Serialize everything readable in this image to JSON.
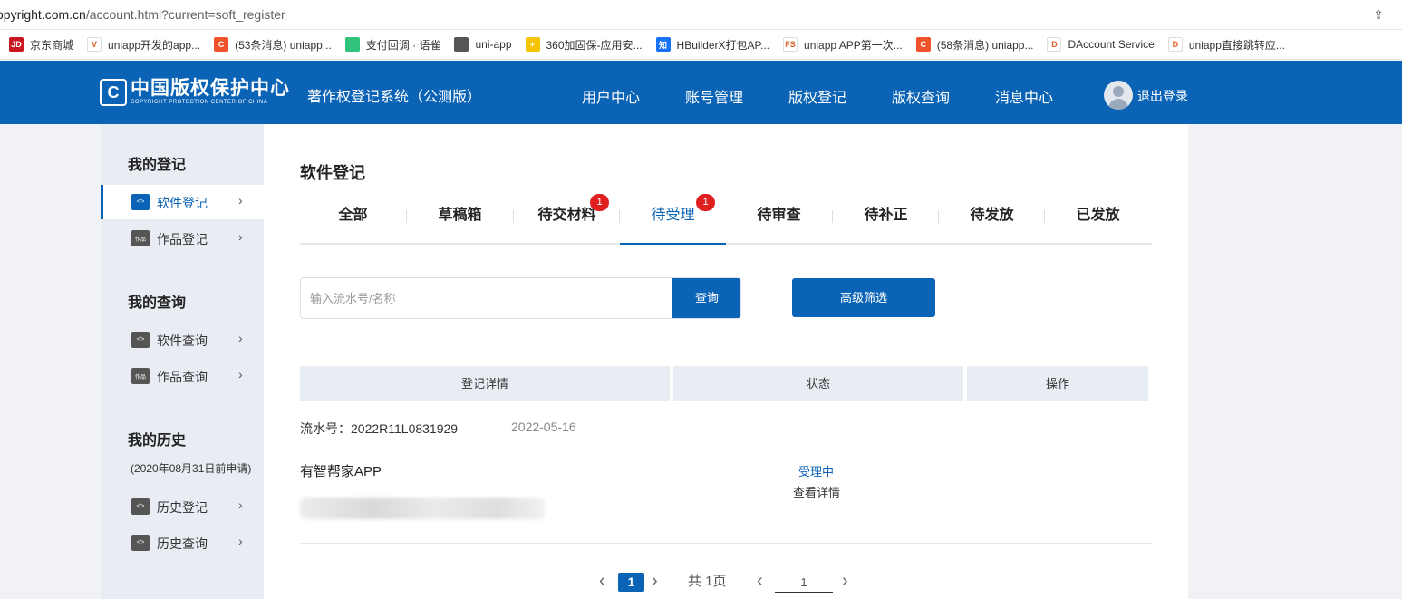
{
  "browser": {
    "url_host": "opyright.com.cn",
    "url_path": "/account.html?current=soft_register",
    "bookmarks": [
      {
        "icon": "jd-icon",
        "badge": "JD",
        "color": "#c81623",
        "label": "京东商城"
      },
      {
        "icon": "uniapp-icon",
        "badge": "V",
        "color": "#ffffff",
        "label": "uniapp开发的app..."
      },
      {
        "icon": "csdn-icon",
        "badge": "C",
        "color": "#f0532a",
        "label": "(53条消息) uniapp..."
      },
      {
        "icon": "yuque-icon",
        "badge": "",
        "color": "#31c27c",
        "label": "支付回调 · 语雀"
      },
      {
        "icon": "globe-icon",
        "badge": "",
        "color": "#555555",
        "label": "uni-app"
      },
      {
        "icon": "360-icon",
        "badge": "+",
        "color": "#f4c500",
        "label": "360加固保-应用安..."
      },
      {
        "icon": "zhihu-icon",
        "badge": "知",
        "color": "#1772f6",
        "label": "HBuilderX打包AP..."
      },
      {
        "icon": "fs-icon",
        "badge": "FS",
        "color": "#ffffff",
        "label": "uniapp APP第一次..."
      },
      {
        "icon": "csdn-icon",
        "badge": "C",
        "color": "#f0532a",
        "label": "(58条消息) uniapp..."
      },
      {
        "icon": "dcloud-icon",
        "badge": "D",
        "color": "#ffffff",
        "label": "DAccount Service"
      },
      {
        "icon": "dcloud-icon",
        "badge": "D",
        "color": "#ffffff",
        "label": "uniapp直接跳转应..."
      }
    ]
  },
  "header": {
    "logo_cn": "中国版权保护中心",
    "logo_en": "COPYRIGHT PROTECTION CENTER OF CHINA",
    "logo_mark": "C",
    "system_name": "著作权登记系统（公测版）",
    "nav": [
      "用户中心",
      "账号管理",
      "版权登记",
      "版权查询",
      "消息中心"
    ],
    "logout": "退出登录",
    "brand_color": "#0a63b4"
  },
  "sidebar": {
    "sections": [
      {
        "title": "我的登记",
        "items": [
          {
            "label": "软件登记",
            "icon": "software-icon",
            "active": true
          },
          {
            "label": "作品登记",
            "icon": "works-icon",
            "active": false
          }
        ]
      },
      {
        "title": "我的查询",
        "items": [
          {
            "label": "软件查询",
            "icon": "software-icon",
            "active": false
          },
          {
            "label": "作品查询",
            "icon": "works-icon",
            "active": false
          }
        ]
      },
      {
        "title": "我的历史",
        "note": "(2020年08月31日前申请)",
        "items": [
          {
            "label": "历史登记",
            "icon": "software-icon",
            "active": false
          },
          {
            "label": "历史查询",
            "icon": "software-icon",
            "active": false
          }
        ]
      }
    ]
  },
  "main": {
    "title": "软件登记",
    "tabs": [
      {
        "label": "全部"
      },
      {
        "label": "草稿箱"
      },
      {
        "label": "待交材料",
        "badge": "1"
      },
      {
        "label": "待受理",
        "badge": "1",
        "active": true
      },
      {
        "label": "待审查"
      },
      {
        "label": "待补正"
      },
      {
        "label": "待发放"
      },
      {
        "label": "已发放"
      }
    ],
    "search": {
      "placeholder": "输入流水号/名称",
      "button": "查询"
    },
    "filter_button": "高级筛选",
    "table_headers": [
      "登记详情",
      "状态",
      "操作"
    ],
    "record": {
      "serial_label": "流水号：",
      "serial": "2022R11L0831929",
      "date": "2022-05-16",
      "name": "有智帮家APP",
      "status": "受理中",
      "detail_link": "查看详情"
    },
    "pagination": {
      "current": "1",
      "total_text": "共 1页",
      "input_value": "1"
    }
  }
}
